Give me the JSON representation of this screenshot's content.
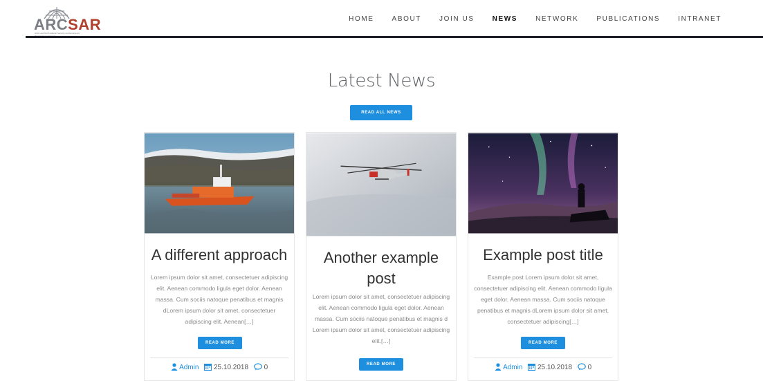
{
  "logo": {
    "text_part1": "ARC",
    "text_part2": "SAR",
    "subtitle": "Arctic and North Atlantic Security and Emergency Preparedness Network"
  },
  "nav": {
    "items": [
      {
        "label": "HOME"
      },
      {
        "label": "ABOUT"
      },
      {
        "label": "JOIN US"
      },
      {
        "label": "NEWS",
        "active": true
      },
      {
        "label": "NETWORK"
      },
      {
        "label": "PUBLICATIONS"
      },
      {
        "label": "INTRANET"
      }
    ]
  },
  "section": {
    "title": "Latest News",
    "read_all_label": "READ ALL NEWS"
  },
  "cards": [
    {
      "title": "A different approach",
      "excerpt": "Lorem ipsum dolor sit amet, consectetuer adipiscing elit. Aenean commodo ligula eget dolor. Aenean massa. Cum sociis natoque penatibus et magnis dLorem ipsum dolor sit amet, consectetuer adipiscing elit. Aenean[…]",
      "button_label": "READ MORE",
      "author": "Admin",
      "date": "25.10.2018",
      "comments": "0"
    },
    {
      "title": "Another example post",
      "excerpt": "Lorem ipsum dolor sit amet, consectetuer adipiscing elit. Aenean commodo ligula eget dolor. Aenean massa. Cum sociis natoque penatibus et magnis d Lorem ipsum dolor sit amet, consectetuer adipiscing elit.[…]",
      "button_label": "READ MORE"
    },
    {
      "title": "Example post title",
      "excerpt": "Example post Lorem ipsum dolor sit amet, consectetuer adipiscing elit. Aenean commodo ligula eget dolor. Aenean massa. Cum sociis natoque penatibus et magnis dLorem ipsum dolor sit amet, consectetuer adipiscing[…]",
      "button_label": "READ MORE",
      "author": "Admin",
      "date": "25.10.2018",
      "comments": "0"
    }
  ],
  "colors": {
    "accent": "#1e8ede",
    "logo_grey": "#7b7f85",
    "logo_red": "#b0402c",
    "header_line": "#1c2026"
  }
}
